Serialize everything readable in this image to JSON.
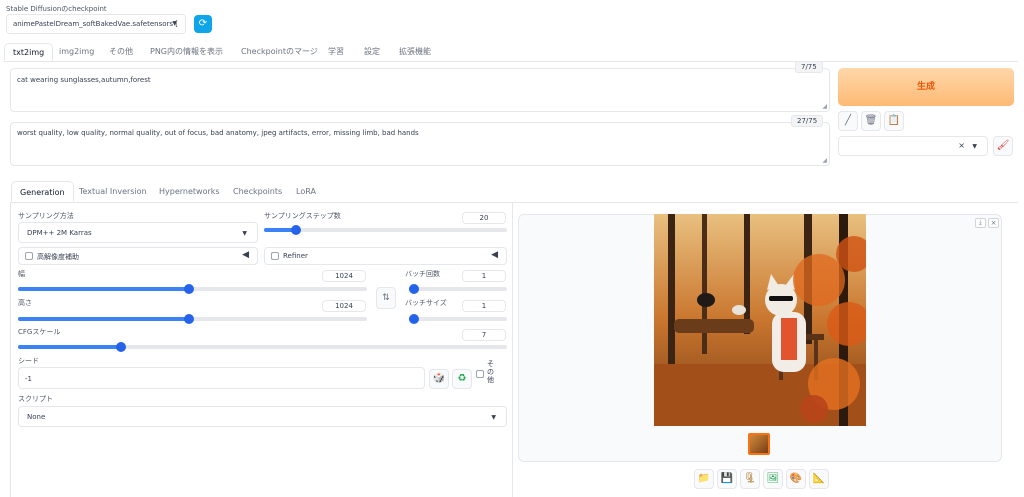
{
  "checkpoint": {
    "label": "Stable Diffusionのcheckpoint",
    "value": "animePastelDream_softBakedVae.safetensors [",
    "refresh_icon": "refresh-icon"
  },
  "tabs": [
    "txt2img",
    "img2img",
    "その他",
    "PNG内の情報を表示",
    "Checkpointのマージ",
    "学習",
    "設定",
    "拡張機能"
  ],
  "prompt": {
    "value": "cat wearing sunglasses,autumn,forest",
    "counter": "7/75"
  },
  "negative_prompt": {
    "value": "worst quality, low quality, normal quality,  out of focus, bad anatomy, jpeg artifacts, error, missing limb, bad hands",
    "counter": "27/75"
  },
  "generate_label": "生成",
  "style_clear": "×",
  "sub_tabs": [
    "Generation",
    "Textual Inversion",
    "Hypernetworks",
    "Checkpoints",
    "LoRA"
  ],
  "sampling": {
    "method_label": "サンプリング方法",
    "method_value": "DPM++ 2M Karras",
    "steps_label": "サンプリングステップ数",
    "steps_value": "20",
    "steps_fraction": 0.13
  },
  "hires_label": "高解像度補助",
  "refiner_label": "Refiner",
  "width": {
    "label": "幅",
    "value": "1024",
    "fraction": 0.49
  },
  "height": {
    "label": "高さ",
    "value": "1024",
    "fraction": 0.49
  },
  "swap_icon": "⇅",
  "batch_count": {
    "label": "バッチ回数",
    "value": "1",
    "fraction": 0.0
  },
  "batch_size": {
    "label": "バッチサイズ",
    "value": "1",
    "fraction": 0.0
  },
  "cfg": {
    "label": "CFGスケール",
    "value": "7",
    "fraction": 0.21
  },
  "seed": {
    "label": "シード",
    "value": "-1",
    "extra_label": "その他"
  },
  "script": {
    "label": "スクリプト",
    "value": "None"
  },
  "output": {
    "image_alt": "Orange cat in sunglasses sitting on a bench in an autumn forest",
    "toolbar_icons": [
      "folder-icon",
      "save-icon",
      "zip-icon",
      "send-to-img2img-icon",
      "send-to-inpaint-icon",
      "send-to-extras-icon"
    ]
  },
  "colors": {
    "accent": "#2563eb",
    "generate_bg": "#fed7aa",
    "generate_text": "#ea580c"
  }
}
